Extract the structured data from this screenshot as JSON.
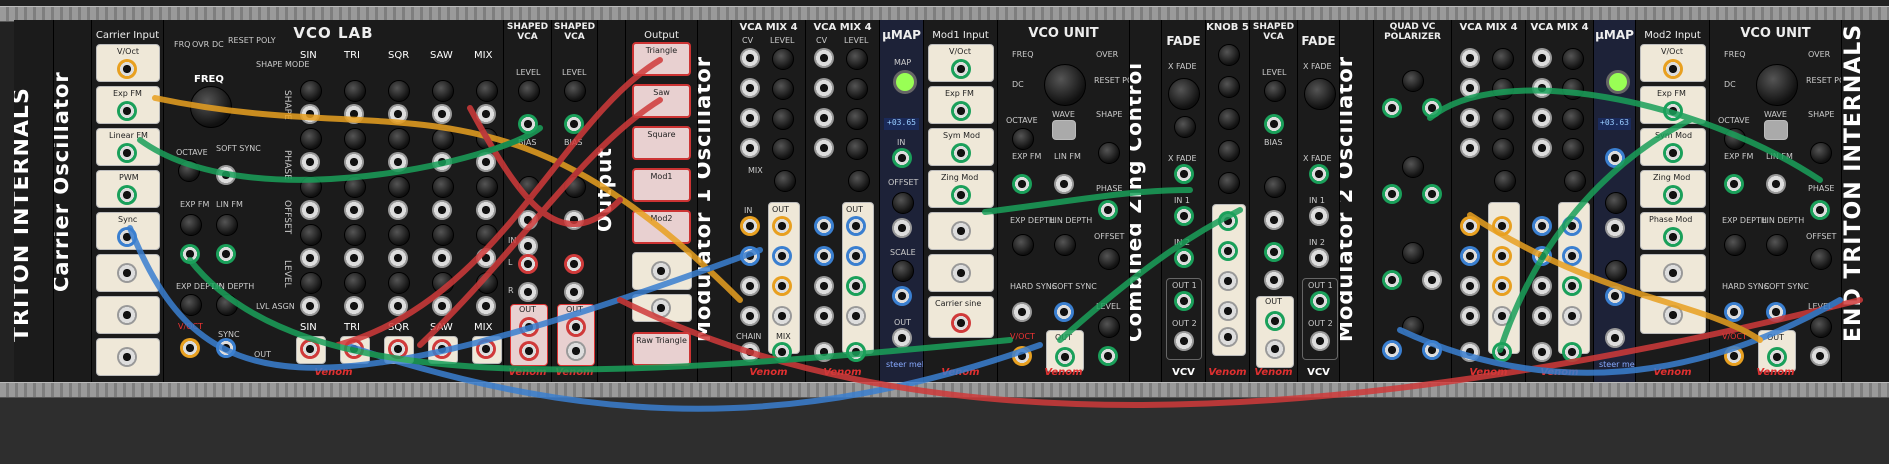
{
  "panels": {
    "triton_internals": "TRITON INTERNALS",
    "carrier_oscillator": "Carrier Oscillator",
    "carrier_input": "Carrier Input",
    "carrier_inputs": [
      "V/Oct",
      "Exp FM",
      "Linear FM",
      "PWM",
      "Sync"
    ],
    "vco_lab": "VCO LAB",
    "vco_lab_cols": [
      "SIN",
      "TRI",
      "SQR",
      "SAW",
      "MIX"
    ],
    "vco_lab_rows": [
      "SHAPE",
      "PHASE",
      "OFFSET",
      "LEVEL"
    ],
    "vco_lab_controls": [
      "FRQ",
      "OVR",
      "DC",
      "RESET POLY",
      "FREQ",
      "OCTAVE",
      "SOFT SYNC",
      "EXP FM",
      "LIN FM",
      "EXP DEPTH",
      "LIN DEPTH",
      "V/OCT",
      "SYNC",
      "OUT",
      "SHAPE MODE",
      "LVL ASGN"
    ],
    "shaped_vca_1": "SHAPED VCA",
    "shaped_vca_2": "SHAPED VCA",
    "vca_labels": [
      "LEVEL",
      "BIAS",
      "IN",
      "L",
      "R",
      "OUT"
    ],
    "output": "Output",
    "output_vertical": "Output",
    "output_labels": [
      "Triangle",
      "Saw",
      "Square",
      "Mod1",
      "Mod2",
      "Raw Triangle"
    ],
    "modulator1_oscillator": "Modulator 1 Oscillator",
    "vca_mix_1": "VCA MIX 4",
    "vca_mix_2": "VCA MIX 4",
    "vca_mix_labels": [
      "CV",
      "LEVEL",
      "MIX",
      "IN",
      "OUT",
      "CHAIN"
    ],
    "umap_1": "µMAP",
    "umap_1_display": "+03.65",
    "umap_labels": [
      "MAP",
      "IN",
      "OFFSET",
      "SCALE",
      "OUT"
    ],
    "umap_brand": "steer melder",
    "mod1_input": "Mod1 Input",
    "mod1_inputs": [
      "V/Oct",
      "Exp FM",
      "Sym Mod",
      "Zing Mod",
      "Carrier sine"
    ],
    "vco_unit_1": "VCO UNIT",
    "vco_unit_labels": [
      "FREQ",
      "DC",
      "OVER",
      "RESET POLY",
      "OCTAVE",
      "WAVE",
      "SHAPE",
      "EXP FM",
      "LIN FM",
      "PHASE",
      "EXP DEPTH",
      "LIN DEPTH",
      "OFFSET",
      "HARD SYNC",
      "SOFT SYNC",
      "LEVEL",
      "V/OCT",
      "OUT"
    ],
    "combined_zing_control": "Combined Zing Control",
    "fade_1": "FADE",
    "knob_5": "KNOB 5",
    "shaped_vca_3": "SHAPED VCA",
    "fade_2": "FADE",
    "fade_labels": [
      "X FADE",
      "IN 1",
      "IN 2",
      "OUT 1",
      "OUT 2"
    ],
    "vcv": "VCV",
    "modulator2_oscillator": "Modulator 2 Oscillator",
    "quad_vc_polarizer": "QUAD VC POLARIZER",
    "vca_mix_3": "VCA MIX 4",
    "vca_mix_4": "VCA MIX 4",
    "umap_2": "µMAP",
    "umap_2_display": "+03.63",
    "mod2_input": "Mod2 Input",
    "mod2_inputs": [
      "V/Oct",
      "Exp FM",
      "Sym Mod",
      "Zing Mod",
      "Phase Mod"
    ],
    "vco_unit_2": "VCO UNIT",
    "end_triton_internals": "END TRITON INTERNALS",
    "brand": "Venom"
  },
  "colors": {
    "green": "#1aa05a",
    "orange": "#e8a020",
    "blue": "#3a7fd0",
    "red": "#d03a3a",
    "panel": "#1b1b1b"
  }
}
